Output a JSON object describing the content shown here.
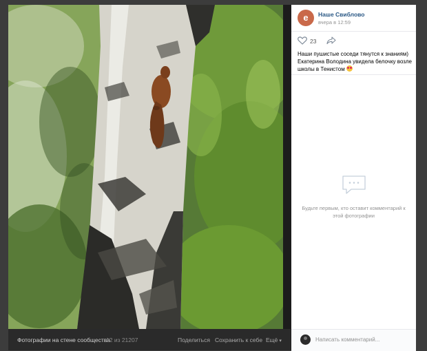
{
  "post": {
    "group_name": "Наше Свиблово",
    "time": "вчера в 12:59",
    "likes": "23",
    "caption": "Наши пушистые соседи тянутся к знаниям) Екатерина Володина увидела белочку возле школы в Тенистом"
  },
  "comments": {
    "empty_text": "Будьте первым, кто оставит комментарий к этой фотографии",
    "input_placeholder": "Написать комментарий..."
  },
  "photo_bar": {
    "album": "Фотографии на стене сообщества",
    "counter": "12 из 21207",
    "share": "Поделиться",
    "save": "Сохранить к себе",
    "more": "Ещё"
  },
  "icons": {
    "avatar": "group-avatar",
    "like": "heart-icon",
    "share": "share-arrow-icon",
    "empty_comments": "speech-bubble-icon",
    "emoji": "heart-eyes-emoji"
  },
  "colors": {
    "link": "#2a5885",
    "muted": "#939393",
    "overlay": "#3c3c3c",
    "photo_bar": "#2a2a2a"
  }
}
